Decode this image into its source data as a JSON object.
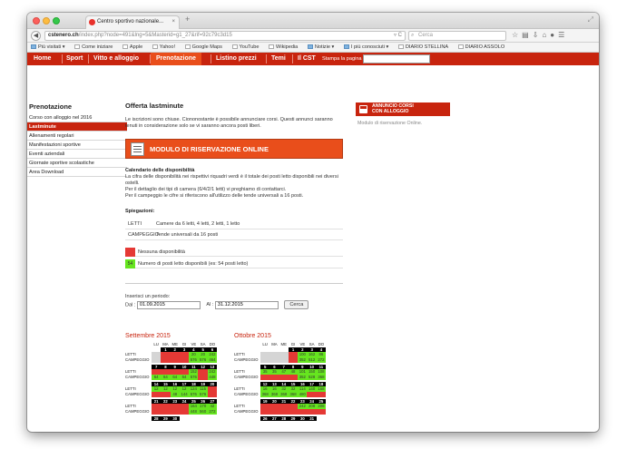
{
  "browser": {
    "tab_title": "Centro sportivo nazionale...",
    "tab_close": "×",
    "new_tab": "+",
    "url_domain": "cstenero.ch",
    "url_path": "/index.php?node=491&lng=5&Masterid=g1_27&rif=92c79c3d15",
    "search_placeholder": "Cerca",
    "bookmarks": [
      "Più visitati",
      "Come iniziare",
      "Apple",
      "Yahoo!",
      "Google Maps",
      "YouTube",
      "Wikipedia",
      "Notizie",
      "I più conosciuti",
      "DIARIO STELLINA",
      "DIARIO ASSOLO"
    ]
  },
  "topnav": {
    "items": [
      "Home",
      "Sport",
      "Vitto e alloggio",
      "Prenotazione",
      "Listino prezzi",
      "Temi",
      "Il CST"
    ],
    "active": "Prenotazione",
    "print_label": "Stampa la pagina"
  },
  "sidebar": {
    "title": "Prenotazione",
    "items": [
      "Corso con alloggio nel 2016",
      "Lastminute",
      "Allenamenti regolari",
      "Manifestazioni sportive",
      "Eventi aziendali",
      "Giornate sportive scolastiche",
      "Area Download"
    ],
    "active_index": 1
  },
  "main": {
    "title": "Offerta lastminute",
    "intro": "Le iscrizioni sono chiuse. Ciononostante è possibile annunciare corsi. Questi annunci saranno tenuti in considerazione solo se vi saranno ancora posti liberi.",
    "modulo_label": "MODULO DI RISERVAZIONE ONLINE",
    "calendar_heading": "Calendario delle disponibilità",
    "calendar_text_1": "La cifra delle disponibilità nei rispettivi riquadri verdi è il totale dei posti letto disponibili nei diversi ostelli.",
    "calendar_text_2": "Per il dettaglio dei tipi di camera (6/4/2/1 letti) vi preghiamo di contattarci.",
    "calendar_text_3": "Per il campeggio le cifre si riferiscono all'utilizzo delle tende universali a 16 posti.",
    "spiegazioni_title": "Spiegazioni:",
    "spiegazioni": [
      {
        "key": "LETTI",
        "value": "Camere da 6 letti, 4 letti, 2 letti, 1 letto"
      },
      {
        "key": "CAMPEGGIO",
        "value": "Tende universali da 16 posti"
      }
    ],
    "legend": [
      {
        "swatch": "",
        "color": "#e53935",
        "text": "Nessuna disponibilità"
      },
      {
        "swatch": "54",
        "color": "#66e51f",
        "text": "Numero di posti letto disponibili (es: 54 posti letto)"
      }
    ],
    "period_label": "Inserisci un periodo:",
    "dal_label": "Dal :",
    "dal_value": "01.09.2015",
    "al_label": "Al :",
    "al_value": "31.12.2015",
    "cerca_label": "Cerca"
  },
  "calendars": [
    {
      "title": "Settembre 2015",
      "day_headers": [
        "LU",
        "MA",
        "ME",
        "GI",
        "VE",
        "SA",
        "DO"
      ],
      "row_labels": [
        "LETTI",
        "CAMPEGGIO"
      ],
      "weeks": [
        {
          "days": [
            "",
            "1",
            "2",
            "3",
            "4",
            "5",
            "6"
          ],
          "letti": [
            [
              "gy",
              ""
            ],
            [
              "rd",
              ""
            ],
            [
              "rd",
              ""
            ],
            [
              "rd",
              ""
            ],
            [
              "gr",
              "20"
            ],
            [
              "gr",
              "20"
            ],
            [
              "gr",
              "242"
            ]
          ],
          "camp": [
            [
              "gy",
              ""
            ],
            [
              "rd",
              ""
            ],
            [
              "rd",
              ""
            ],
            [
              "rd",
              ""
            ],
            [
              "gr",
              "576"
            ],
            [
              "gr",
              "576"
            ],
            [
              "gr",
              "464"
            ]
          ]
        },
        {
          "days": [
            "7",
            "8",
            "9",
            "10",
            "11",
            "12",
            "13"
          ],
          "letti": [
            [
              "rd",
              ""
            ],
            [
              "rd",
              ""
            ],
            [
              "rd",
              ""
            ],
            [
              "rd",
              ""
            ],
            [
              "gr",
              "152"
            ],
            [
              "rd",
              ""
            ],
            [
              "gr",
              "242"
            ]
          ],
          "camp": [
            [
              "gr",
              "64"
            ],
            [
              "gr",
              "64"
            ],
            [
              "gr",
              "64"
            ],
            [
              "gr",
              "64"
            ],
            [
              "gr",
              "576"
            ],
            [
              "rd",
              ""
            ],
            [
              "gr",
              "448"
            ]
          ]
        },
        {
          "days": [
            "14",
            "15",
            "16",
            "17",
            "18",
            "19",
            "20"
          ],
          "letti": [
            [
              "gr",
              "12"
            ],
            [
              "gr",
              "12"
            ],
            [
              "gr",
              "12"
            ],
            [
              "gr",
              "12"
            ],
            [
              "gr",
              "124"
            ],
            [
              "gr",
              "115"
            ],
            [
              "rd",
              ""
            ]
          ],
          "camp": [
            [
              "rd",
              ""
            ],
            [
              "rd",
              ""
            ],
            [
              "gr",
              "48"
            ],
            [
              "gr",
              "144"
            ],
            [
              "gr",
              "576"
            ],
            [
              "gr",
              "576"
            ],
            [
              "rd",
              ""
            ]
          ]
        },
        {
          "days": [
            "21",
            "22",
            "23",
            "24",
            "25",
            "26",
            "27"
          ],
          "letti": [
            [
              "rd",
              ""
            ],
            [
              "rd",
              ""
            ],
            [
              "rd",
              ""
            ],
            [
              "rd",
              ""
            ],
            [
              "gr",
              "164"
            ],
            [
              "gr",
              "170"
            ],
            [
              "gr",
              "42"
            ]
          ],
          "camp": [
            [
              "rd",
              ""
            ],
            [
              "rd",
              ""
            ],
            [
              "rd",
              ""
            ],
            [
              "rd",
              ""
            ],
            [
              "gr",
              "448"
            ],
            [
              "gr",
              "560"
            ],
            [
              "gr",
              "272"
            ]
          ]
        },
        {
          "days": [
            "28",
            "29",
            "30",
            "",
            "",
            "",
            ""
          ],
          "letti": [],
          "camp": []
        }
      ]
    },
    {
      "title": "Ottobre 2015",
      "day_headers": [
        "LU",
        "MA",
        "ME",
        "GI",
        "VE",
        "SA",
        "DO"
      ],
      "row_labels": [
        "LETTI",
        "CAMPEGGIO"
      ],
      "weeks": [
        {
          "days": [
            "",
            "",
            "",
            "1",
            "2",
            "3",
            "4"
          ],
          "letti": [
            [
              "gy",
              ""
            ],
            [
              "gy",
              ""
            ],
            [
              "gy",
              ""
            ],
            [
              "rd",
              ""
            ],
            [
              "gr",
              "100"
            ],
            [
              "gr",
              "162"
            ],
            [
              "gr",
              "86"
            ]
          ],
          "camp": [
            [
              "gy",
              ""
            ],
            [
              "gy",
              ""
            ],
            [
              "gy",
              ""
            ],
            [
              "rd",
              ""
            ],
            [
              "gr",
              "352"
            ],
            [
              "gr",
              "512"
            ],
            [
              "gr",
              "272"
            ]
          ]
        },
        {
          "days": [
            "5",
            "6",
            "7",
            "8",
            "9",
            "10",
            "11"
          ],
          "letti": [
            [
              "gr",
              "35"
            ],
            [
              "gr",
              "35"
            ],
            [
              "gr",
              "47"
            ],
            [
              "gr",
              "48"
            ],
            [
              "gr",
              "101"
            ],
            [
              "gr",
              "150"
            ],
            [
              "gr",
              "108"
            ]
          ],
          "camp": [
            [
              "rd",
              ""
            ],
            [
              "rd",
              ""
            ],
            [
              "rd",
              ""
            ],
            [
              "rd",
              ""
            ],
            [
              "gr",
              "352"
            ],
            [
              "gr",
              "528"
            ],
            [
              "gr",
              "368"
            ]
          ]
        },
        {
          "days": [
            "12",
            "13",
            "14",
            "15",
            "16",
            "17",
            "18"
          ],
          "letti": [
            [
              "gr",
              "16"
            ],
            [
              "gr",
              "16"
            ],
            [
              "gr",
              "32"
            ],
            [
              "gr",
              "32"
            ],
            [
              "gr",
              "114"
            ],
            [
              "gr",
              "140"
            ],
            [
              "gr",
              "168"
            ]
          ],
          "camp": [
            [
              "gr",
              "368"
            ],
            [
              "gr",
              "368"
            ],
            [
              "gr",
              "368"
            ],
            [
              "gr",
              "368"
            ],
            [
              "gr",
              "480"
            ],
            [
              "rd",
              ""
            ],
            [
              "rd",
              ""
            ]
          ]
        },
        {
          "days": [
            "19",
            "20",
            "21",
            "22",
            "23",
            "24",
            "25"
          ],
          "letti": [
            [
              "rd",
              ""
            ],
            [
              "rd",
              ""
            ],
            [
              "rd",
              ""
            ],
            [
              "rd",
              ""
            ],
            [
              "gr",
              "242"
            ],
            [
              "gr",
              "208"
            ],
            [
              "gr",
              "208"
            ]
          ],
          "camp": [
            [
              "rd",
              ""
            ],
            [
              "rd",
              ""
            ],
            [
              "rd",
              ""
            ],
            [
              "rd",
              ""
            ],
            [
              "rd",
              ""
            ],
            [
              "rd",
              ""
            ],
            [
              "rd",
              ""
            ]
          ]
        },
        {
          "days": [
            "26",
            "27",
            "28",
            "29",
            "30",
            "31",
            ""
          ],
          "letti": [],
          "camp": []
        }
      ]
    }
  ],
  "rightbox": {
    "title_1": "ANNUNCIO CORSI",
    "title_2": "CON ALLOGGIO",
    "text": "Modulo di riservazione Online."
  },
  "colors": {
    "brand_red": "#c8240e",
    "active_orange": "#e94e1b",
    "available_green": "#66e51f",
    "unavailable_red": "#e53935"
  }
}
